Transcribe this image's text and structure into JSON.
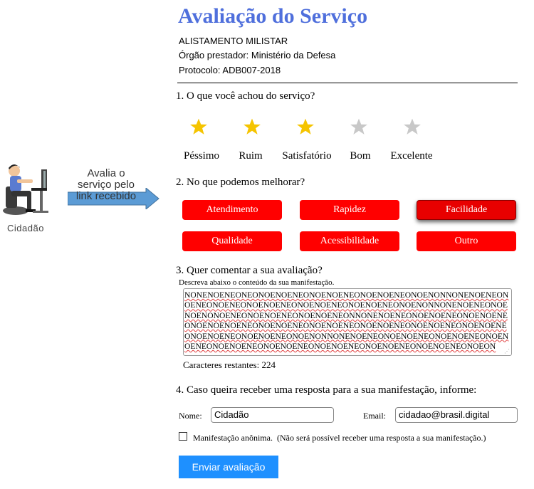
{
  "flow": {
    "actor_label": "Cidadão",
    "arrow_text": [
      "Avalia o",
      "serviço pelo",
      "link recebido"
    ]
  },
  "header": {
    "title": "Avaliação do Serviço",
    "service": "ALISTAMENTO MILISTAR",
    "organ": "Órgão prestador: Ministério da Defesa",
    "protocol": "Protocolo: ADB007-2018"
  },
  "questions": {
    "q1": "1. O que você achou do serviço?",
    "q2": "2. No que podemos melhorar?",
    "q3": "3. Quer comentar a sua avaliação?",
    "q4": "4. Caso queira receber uma resposta para a sua manifestação, informe:"
  },
  "rating": {
    "value": 3,
    "max": 5,
    "filled_color": "#f5c400",
    "empty_color": "#c8c8c8",
    "labels": [
      "Péssimo",
      "Ruim",
      "Satisfatório",
      "Bom",
      "Excelente"
    ]
  },
  "improvements": {
    "options": [
      "Atendimento",
      "Rapidez",
      "Facilidade",
      "Qualidade",
      "Acessibilidade",
      "Outro"
    ],
    "selected": "Facilidade",
    "color": "#ff0000"
  },
  "comment": {
    "label": "Descreva abaixo o conteúdo da sua manifestação.",
    "value": "NONENOENEONEONOENOENEONOENOENEONOENOENEONOENONNONENOENEONOENEONOENEONOENOENEONOENOENEONOENOENEONOENONNONENOENEONOENOENONOENEONOENOENEONOENOENEONNONENOENEONOENOENEONOENOENEONOENOENOENEONOENOENEONOENOENEONOENOENEONOENOENEONOENOENEONOENOENEONOENOENEONOENONNONENOENEONOENOENEONOENOENEONOENOENEONOENOENEONOENOENEONOENOENEONOENOENEONOENOENEONOEON",
    "remaining": "Caracteres restantes: 224"
  },
  "contact": {
    "name_label": "Nome:",
    "name_value": "Cidadão",
    "email_label": "Email:",
    "email_value": "cidadao@brasil.digital",
    "anonymous_label": "Manifestação anônima.",
    "anonymous_note": "(Não será possível receber uma resposta a sua manifestação.)",
    "anonymous_checked": false
  },
  "submit": {
    "label": "Enviar avaliação",
    "color": "#1e90ff"
  }
}
